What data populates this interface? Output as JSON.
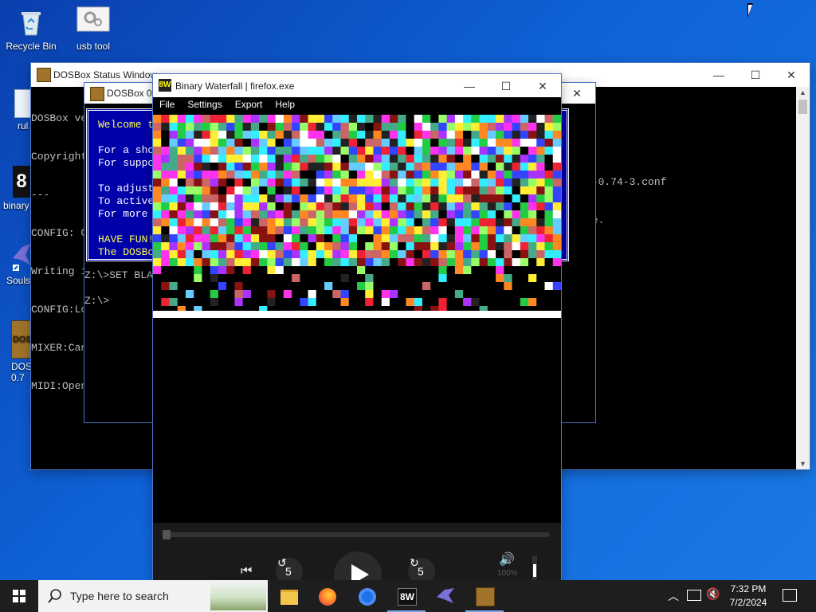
{
  "desktop": {
    "icons": [
      {
        "label": "Recycle Bin"
      },
      {
        "label": "usb tool"
      },
      {
        "label": "rul"
      },
      {
        "label": "binary"
      },
      {
        "label": "Souls"
      },
      {
        "label": "DOS 0.7"
      }
    ]
  },
  "status_window": {
    "title": "DOSBox Status Window",
    "lines": [
      "DOSBox ve",
      "Copyright",
      "---",
      "CONFIG: C",
      "Writing i",
      "CONFIG:Lo",
      "MIXER:Can",
      "MIDI:Open"
    ],
    "right_lines": [
      "x-0.74-3.conf",
      "de."
    ]
  },
  "dosbox_window": {
    "title": "DOSBox 0.7",
    "blue_box": {
      "welcome": "Welcome t",
      "line1": "For a sho",
      "line2": "For suppo",
      "line3": "To adjust",
      "line4": "To active",
      "line5": "For more",
      "fun1": "HAVE FUN!",
      "fun2": "The DOSBo"
    },
    "prompt1": "Z:\\>SET BLA",
    "prompt2": "Z:\\>"
  },
  "waterfall_window": {
    "title": "Binary Waterfall | firefox.exe",
    "icon_text": "8W",
    "menu": [
      "File",
      "Settings",
      "Export",
      "Help"
    ],
    "skip_back_label": "5",
    "skip_forward_label": "5",
    "volume_label": "100%"
  },
  "taskbar": {
    "search_placeholder": "Type here to search",
    "time": "7:32 PM",
    "date": "7/2/2024",
    "bw_icon_text": "8W"
  },
  "colors": {
    "desktop": "#0f63d8",
    "dos_blue": "#0000aa",
    "taskbar": "#1e1e1e"
  }
}
